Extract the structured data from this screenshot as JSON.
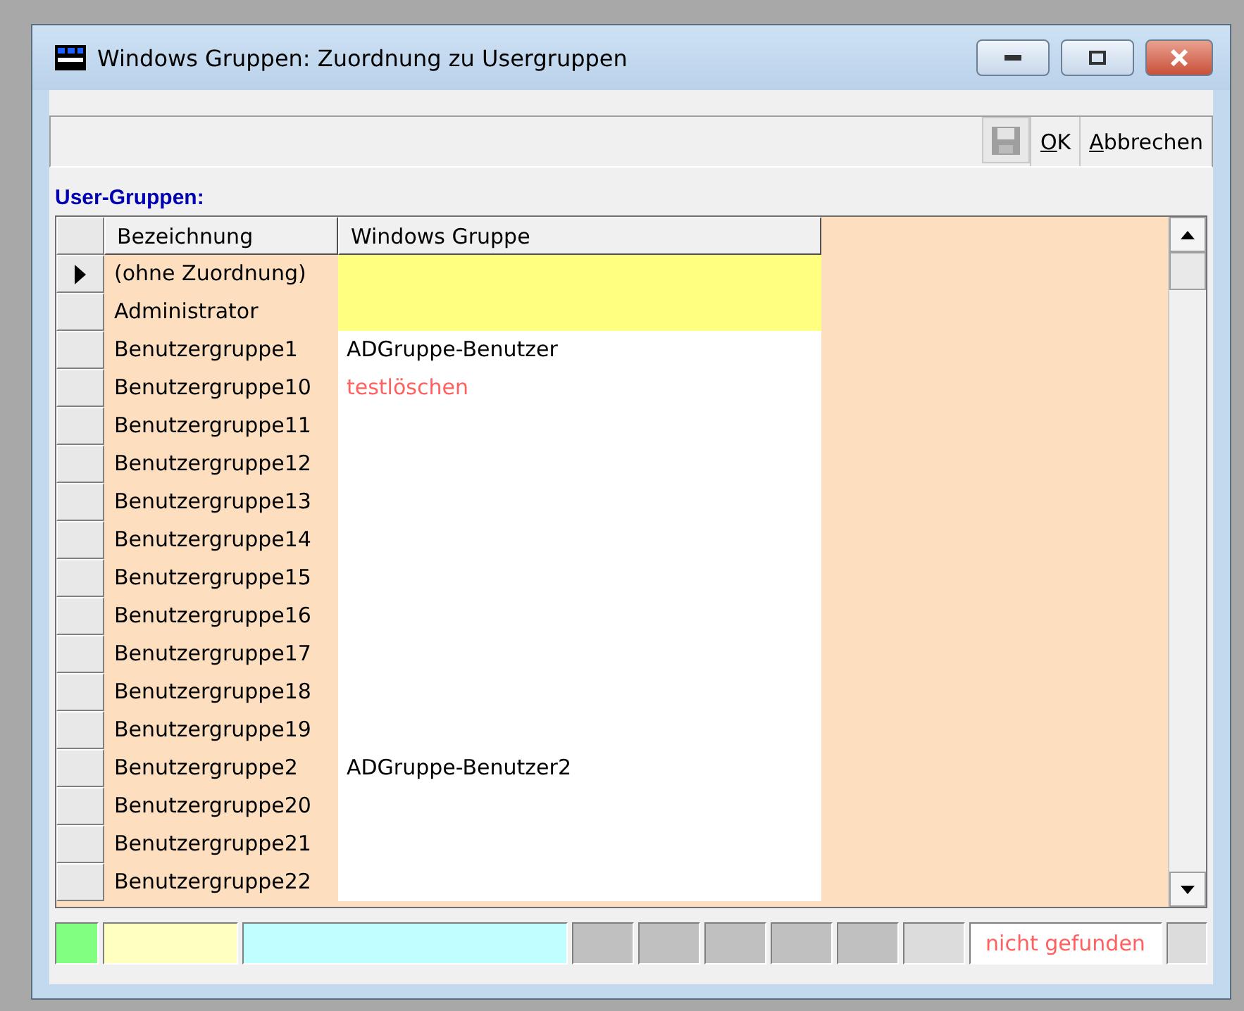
{
  "window": {
    "title": "Windows Gruppen: Zuordnung zu Usergruppen"
  },
  "toolbar": {
    "buttons": [
      {
        "kind": "save",
        "disabled": true
      },
      {
        "kind": "text",
        "label": "OK"
      },
      {
        "kind": "text",
        "label": "Abbrechen"
      }
    ]
  },
  "section_label": "User-Gruppen:",
  "table": {
    "columns": [
      "Bezeichnung",
      "Windows Gruppe"
    ],
    "rows": [
      {
        "name": "(ohne Zuordnung)",
        "selected": true,
        "highlighted": true
      },
      {
        "name": "Administrator",
        "selected": false,
        "highlighted": true
      },
      {
        "name": "Benutzergruppe1",
        "selected": false,
        "highlighted": false,
        "group": "ADGruppe-Benutzer",
        "found": true
      },
      {
        "name": "Benutzergruppe10",
        "selected": false,
        "highlighted": false,
        "group": "testlöschen",
        "found": false
      },
      {
        "name": "Benutzergruppe11",
        "selected": false,
        "highlighted": false
      },
      {
        "name": "Benutzergruppe12",
        "selected": false,
        "highlighted": false
      },
      {
        "name": "Benutzergruppe13",
        "selected": false,
        "highlighted": false
      },
      {
        "name": "Benutzergruppe14",
        "selected": false,
        "highlighted": false
      },
      {
        "name": "Benutzergruppe15",
        "selected": false,
        "highlighted": false
      },
      {
        "name": "Benutzergruppe16",
        "selected": false,
        "highlighted": false
      },
      {
        "name": "Benutzergruppe17",
        "selected": false,
        "highlighted": false
      },
      {
        "name": "Benutzergruppe18",
        "selected": false,
        "highlighted": false
      },
      {
        "name": "Benutzergruppe19",
        "selected": false,
        "highlighted": false
      },
      {
        "name": "Benutzergruppe2",
        "selected": false,
        "highlighted": false,
        "group": "ADGruppe-Benutzer2",
        "found": true
      },
      {
        "name": "Benutzergruppe20",
        "selected": false,
        "highlighted": false
      },
      {
        "name": "Benutzergruppe21",
        "selected": false,
        "highlighted": false
      },
      {
        "name": "Benutzergruppe22",
        "selected": false,
        "highlighted": false
      }
    ]
  },
  "status_bar": [
    {
      "color": "#80ff80"
    },
    {
      "color": "#ffffc0"
    },
    {
      "color": "#c0ffff"
    },
    {
      "color": "#c0c0c0"
    },
    {
      "color": "#c0c0c0"
    },
    {
      "color": "#c0c0c0"
    },
    {
      "color": "#c0c0c0"
    },
    {
      "color": "#c0c0c0"
    },
    {
      "color": "#dcdcdc"
    },
    {
      "color": "#ffffff",
      "text": "nicht gefunden"
    },
    {
      "color": "#dcdcdc"
    }
  ]
}
